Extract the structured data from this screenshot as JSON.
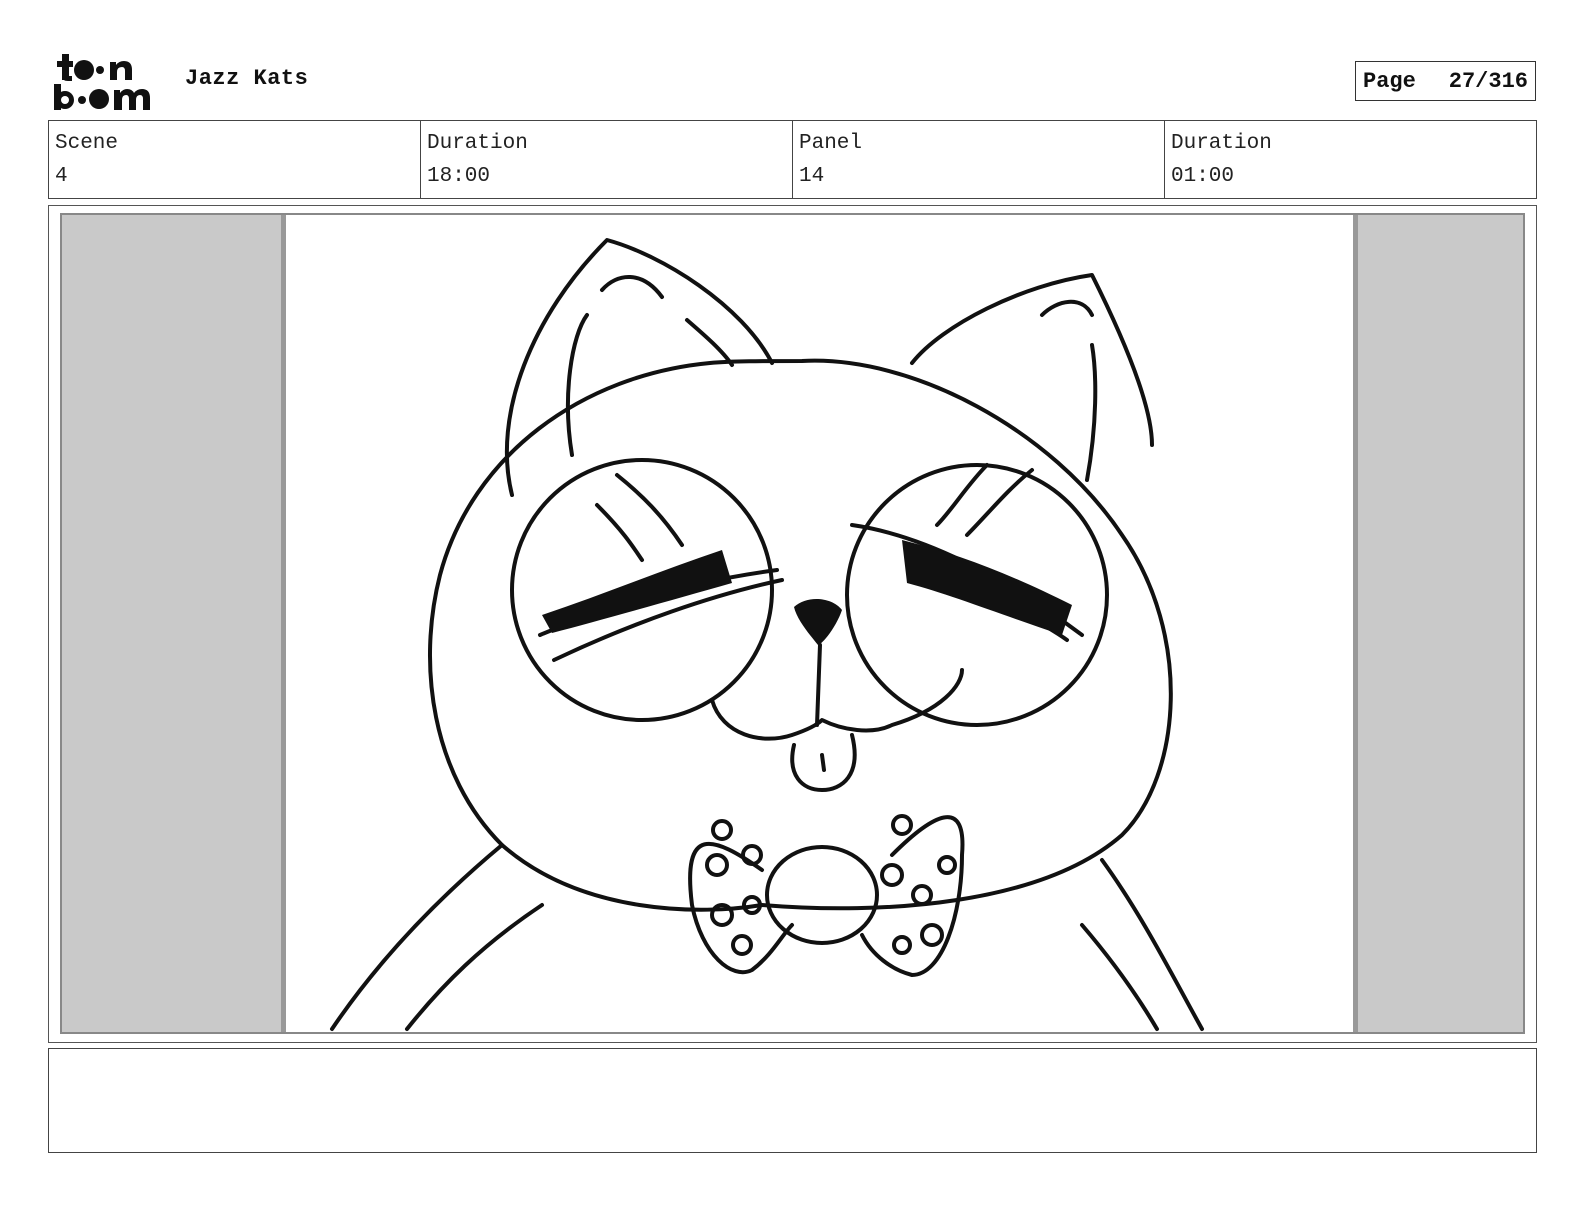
{
  "header": {
    "logo_icon": "toon-boom-logo",
    "project_title": "Jazz Kats",
    "page_label": "Page",
    "page_number": "27/316"
  },
  "info": {
    "scene_label": "Scene",
    "scene_value": "4",
    "scene_duration_label": "Duration",
    "scene_duration_value": "18:00",
    "panel_label": "Panel",
    "panel_value": "14",
    "panel_duration_label": "Duration",
    "panel_duration_value": "01:00"
  },
  "panel": {
    "image_icon": "cat-with-bowtie-sketch",
    "mask_color": "#c9c9c9"
  },
  "notes": {
    "text": ""
  }
}
